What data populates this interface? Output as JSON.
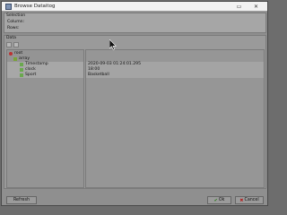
{
  "window": {
    "title": "Browse Dataitog"
  },
  "selection": {
    "legend": "Selection",
    "columns_label": "Column:",
    "rows_label": "Rows:"
  },
  "data": {
    "legend": "Data",
    "tree": [
      {
        "label": "root",
        "icon": "root-node-icon"
      },
      {
        "label": "array",
        "icon": "array-node-icon"
      },
      {
        "label": "Timestamp",
        "icon": "field-node-icon"
      },
      {
        "label": "clock",
        "icon": "field-node-icon"
      },
      {
        "label": "Sport",
        "icon": "field-node-icon"
      }
    ],
    "values": [
      "2020-09-03 01:24:01.295",
      "18:00",
      "Basketball"
    ]
  },
  "buttons": {
    "refresh": "Refresh",
    "ok": "Ok",
    "cancel": "Cancel"
  }
}
